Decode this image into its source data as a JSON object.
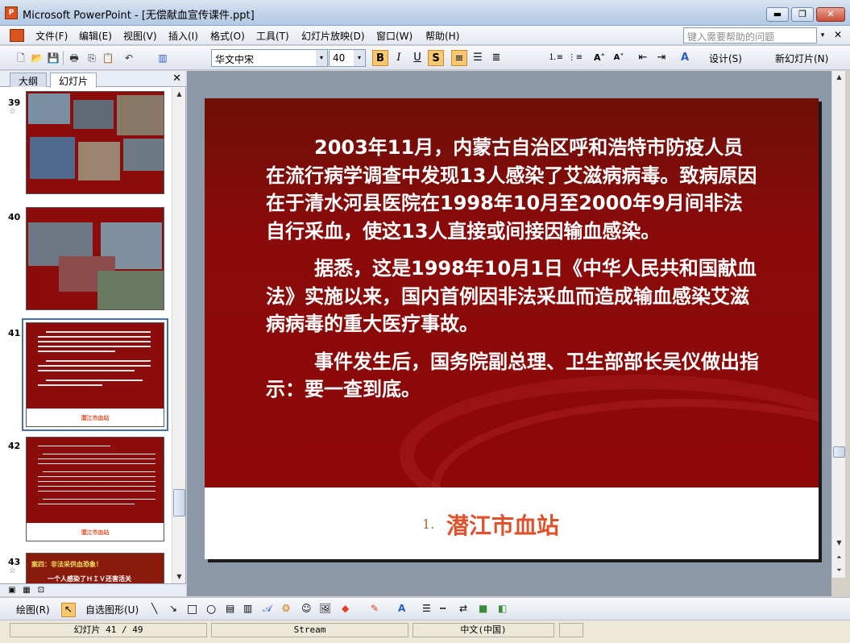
{
  "window": {
    "title": "Microsoft PowerPoint - [无偿献血宣传课件.ppt]",
    "minimize_glyph": "▬",
    "maximize_glyph": "❐",
    "close_glyph": "✕"
  },
  "menu": {
    "items": [
      "文件(F)",
      "编辑(E)",
      "视图(V)",
      "插入(I)",
      "格式(O)",
      "工具(T)",
      "幻灯片放映(D)",
      "窗口(W)",
      "帮助(H)"
    ],
    "help_placeholder": "键入需要帮助的问题",
    "help_dropdown_glyph": "▾",
    "doc_close_glyph": "✕"
  },
  "toolbar": {
    "font_name": "华文中宋",
    "font_size": "40",
    "dropdown_glyph": "▾",
    "bold": "B",
    "italic": "I",
    "underline": "U",
    "shadow": "S",
    "design_label": "设计(S)",
    "new_slide_label": "新幻灯片(N)",
    "icons": {
      "new": "🗋",
      "open": "📂",
      "save": "💾",
      "print": "🖶",
      "copy": "⎘",
      "paste": "📋",
      "undo": "↶",
      "chart": "▥",
      "align_left": "≡",
      "center": "☰",
      "align_right": "≣",
      "bullets": "⋮≡",
      "numbering": "⒈≡",
      "grow_font": "A˄",
      "shrink_font": "A˅",
      "decrease_indent": "⇤",
      "increase_indent": "⇥",
      "font_color": "A"
    }
  },
  "left_panel": {
    "tab_outline": "大纲",
    "tab_slides": "幻灯片",
    "close_glyph": "✕",
    "slides": [
      {
        "number": "39",
        "star": "☆"
      },
      {
        "number": "40"
      },
      {
        "number": "41"
      },
      {
        "number": "42"
      },
      {
        "number": "43",
        "star": "☆"
      }
    ],
    "view_icons": {
      "normal": "▣",
      "sorter": "▦",
      "show": "⊡"
    }
  },
  "slide": {
    "paragraphs": [
      "2003年11月，内蒙古自治区呼和浩特市防疫人员在流行病学调查中发现13人感染了艾滋病病毒。致病原因在于清水河县医院在1998年10月至2000年9月间非法自行采血，使这13人直接或间接因输血感染。",
      "据悉，这是1998年10月1日《中华人民共和国献血法》实施以来，国内首例因非法采血而造成输血感染艾滋病病毒的重大医疗事故。",
      "事件发生后，国务院副总理、卫生部部长吴仪做出指示：要一查到底。"
    ],
    "footer_number": "1.",
    "footer_text": "潜江市血站",
    "footer_color": "#e0502a",
    "background_color": "#8e0808"
  },
  "thumbnails": {
    "slide43_title": "案四：非法采供血恐象！",
    "slide43_line": "一个人感染了ＨＩＶ还害活关",
    "footer_label": "潜江市血站"
  },
  "scroll": {
    "up_glyph": "▲",
    "down_glyph": "▼",
    "prev_glyph": "⏶",
    "next_glyph": "⏷"
  },
  "drawing_toolbar": {
    "draw_label": "绘图(R)",
    "autoshapes_label": "自选图形(U)",
    "icons": {
      "pointer": "↖",
      "line": "╲",
      "arrow": "↘",
      "rect": "□",
      "oval": "○",
      "textbox": "▤",
      "vtext": "▥",
      "wordart": "𝒜",
      "diagram": "❂",
      "clipart": "☺",
      "picture": "🖼",
      "fill": "◆",
      "line_color": "✎",
      "font_color": "A",
      "line_style": "☰",
      "dash_style": "┅",
      "arrow_style": "⇄",
      "shadow": "■",
      "three_d": "◧"
    }
  },
  "status": {
    "slide_position": "幻灯片 41 / 49",
    "design": "Stream",
    "language": "中文(中国)"
  }
}
